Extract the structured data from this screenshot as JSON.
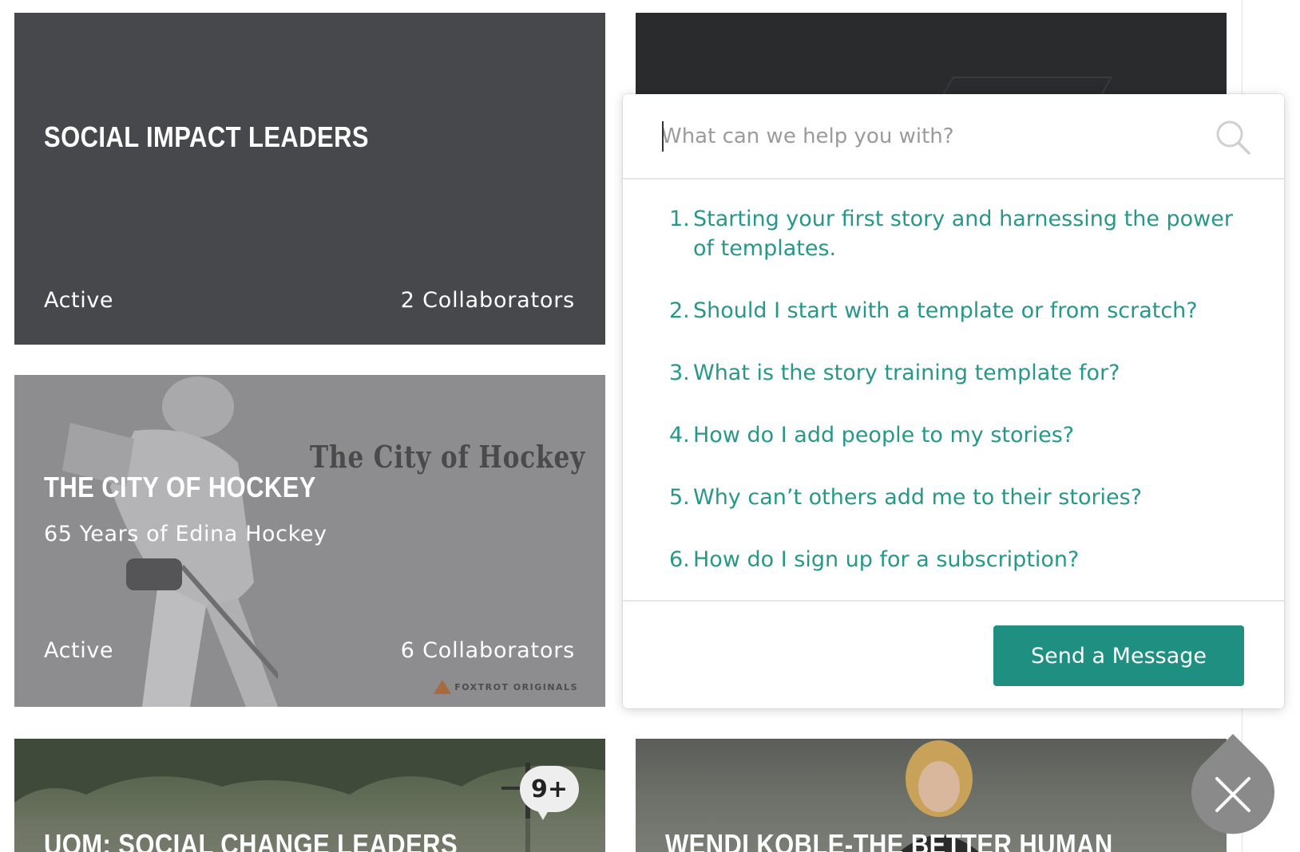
{
  "cards": [
    {
      "title": "SOCIAL IMPACT LEADERS",
      "status": "Active",
      "collaborators": "2 Collaborators"
    },
    {
      "title": "THE CITY OF HOCKEY",
      "subtitle": "65 Years of Edina Hockey",
      "poster_text": "The City of Hockey",
      "brand": "FOXTROT ORIGINALS",
      "status": "Active",
      "collaborators": "6 Collaborators"
    },
    {
      "title": "UOM: SOCIAL CHANGE LEADERS",
      "badge": "9+"
    },
    {
      "title": "WENDI KOBLE-THE BETTER HUMAN"
    }
  ],
  "help": {
    "search_placeholder": "What can we help you with?",
    "faq": [
      {
        "num": "1.",
        "text": "Starting your first story and harnessing the power of templates."
      },
      {
        "num": "2.",
        "text": "Should I start with a template or from scratch?"
      },
      {
        "num": "3.",
        "text": "What is the story training template for?"
      },
      {
        "num": "4.",
        "text": "How do I add people to my stories?"
      },
      {
        "num": "5.",
        "text": "Why can’t others add me to their stories?"
      },
      {
        "num": "6.",
        "text": "How do I sign up for a subscription?"
      }
    ],
    "send_label": "Send a Message"
  },
  "colors": {
    "accent": "#1f8f82",
    "link": "#27978a",
    "fab": "#8a8a8a"
  },
  "icons": {
    "search": "search-icon",
    "close": "close-icon"
  }
}
